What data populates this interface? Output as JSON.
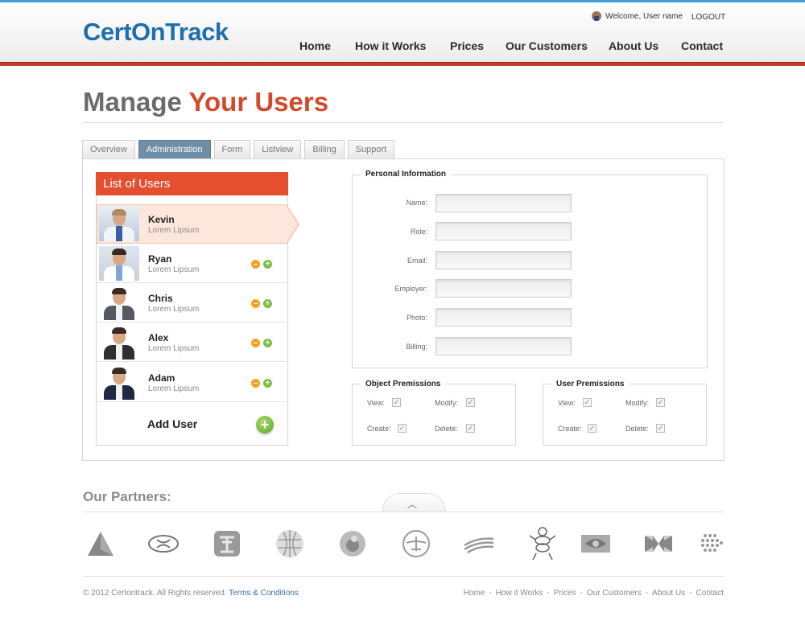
{
  "header": {
    "logo": "CertOnTrack",
    "welcome": "Welcome, User name",
    "logout": "LOGOUT",
    "nav": [
      "Home",
      "How it Works",
      "Prices",
      "Our Customers",
      "About Us",
      "Contact"
    ]
  },
  "page": {
    "title_part1": "Manage",
    "title_part2": "Your Users"
  },
  "tabs": [
    "Overview",
    "Administration",
    "Form",
    "Listview",
    "Billing",
    "Support"
  ],
  "active_tab": "Administration",
  "users_list": {
    "heading": "List of Users",
    "users": [
      {
        "name": "Kevin",
        "subtitle": "Lorem Lipsum"
      },
      {
        "name": "Ryan",
        "subtitle": "Lorem Lipsum"
      },
      {
        "name": "Chris",
        "subtitle": "Lorem Lipsum"
      },
      {
        "name": "Alex",
        "subtitle": "Lorem Lipsum"
      },
      {
        "name": "Adam",
        "subtitle": "Lorem Lipsum"
      }
    ],
    "add_user": "Add User"
  },
  "personal_info": {
    "legend": "Personal Information",
    "fields": [
      {
        "label": "Name:",
        "value": ""
      },
      {
        "label": "Role:",
        "value": ""
      },
      {
        "label": "Email:",
        "value": ""
      },
      {
        "label": "Employer:",
        "value": ""
      },
      {
        "label": "Photo:",
        "value": ""
      },
      {
        "label": "Billing:",
        "value": ""
      }
    ]
  },
  "object_permissions": {
    "legend": "Object Premissions",
    "view": "View:",
    "modify": "Modify:",
    "create": "Create:",
    "delete": "Delete:"
  },
  "user_permissions": {
    "legend": "User Premissions",
    "view": "View:",
    "modify": "Modify:",
    "create": "Create:",
    "delete": "Delete:"
  },
  "partners": {
    "title": "Our Partners:",
    "logos": [
      "delta-logo-icon",
      "hyundai-logo-icon",
      "chinese-seal-logo-icon",
      "wikipedia-logo-icon",
      "vodafone-logo-icon",
      "lufthansa-logo-icon",
      "bank-of-america-logo-icon",
      "michelin-logo-icon",
      "nvidia-logo-icon",
      "hsbc-logo-icon",
      "dotted-globe-logo-icon"
    ]
  },
  "footer": {
    "copyright": "© 2012 Certontrack. All Rights reserved.",
    "terms": "Terms & Conditions",
    "nav": [
      "Home",
      "How it Works",
      "Prices",
      "Our Customers",
      "About Us",
      "Contact"
    ],
    "separator": "-"
  },
  "colors": {
    "brand_blue": "#1f6fad",
    "accent_red": "#d24a2a",
    "list_header": "#e34f2f",
    "active_tab": "#6f8ea8",
    "top_line": "#3aa0dc"
  }
}
